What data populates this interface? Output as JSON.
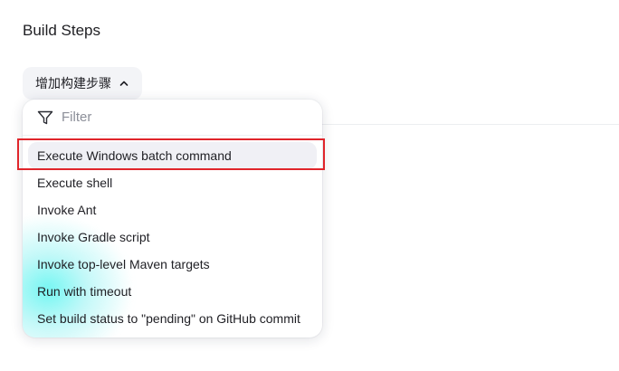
{
  "section": {
    "title": "Build Steps"
  },
  "add_step_button": {
    "label": "增加构建步骤",
    "icon": "chevron-up-icon"
  },
  "dropdown": {
    "filter": {
      "icon": "filter-icon",
      "placeholder": "Filter",
      "value": ""
    },
    "items": [
      {
        "label": "Execute Windows batch command",
        "active": true
      },
      {
        "label": "Execute shell"
      },
      {
        "label": "Invoke Ant"
      },
      {
        "label": "Invoke Gradle script"
      },
      {
        "label": "Invoke top-level Maven targets"
      },
      {
        "label": "Run with timeout"
      },
      {
        "label": "Set build status to \"pending\" on GitHub commit"
      }
    ]
  },
  "colors": {
    "highlight_border": "#e0252b",
    "active_item_bg": "#f0f0f5",
    "glow": "#5af5f0"
  }
}
